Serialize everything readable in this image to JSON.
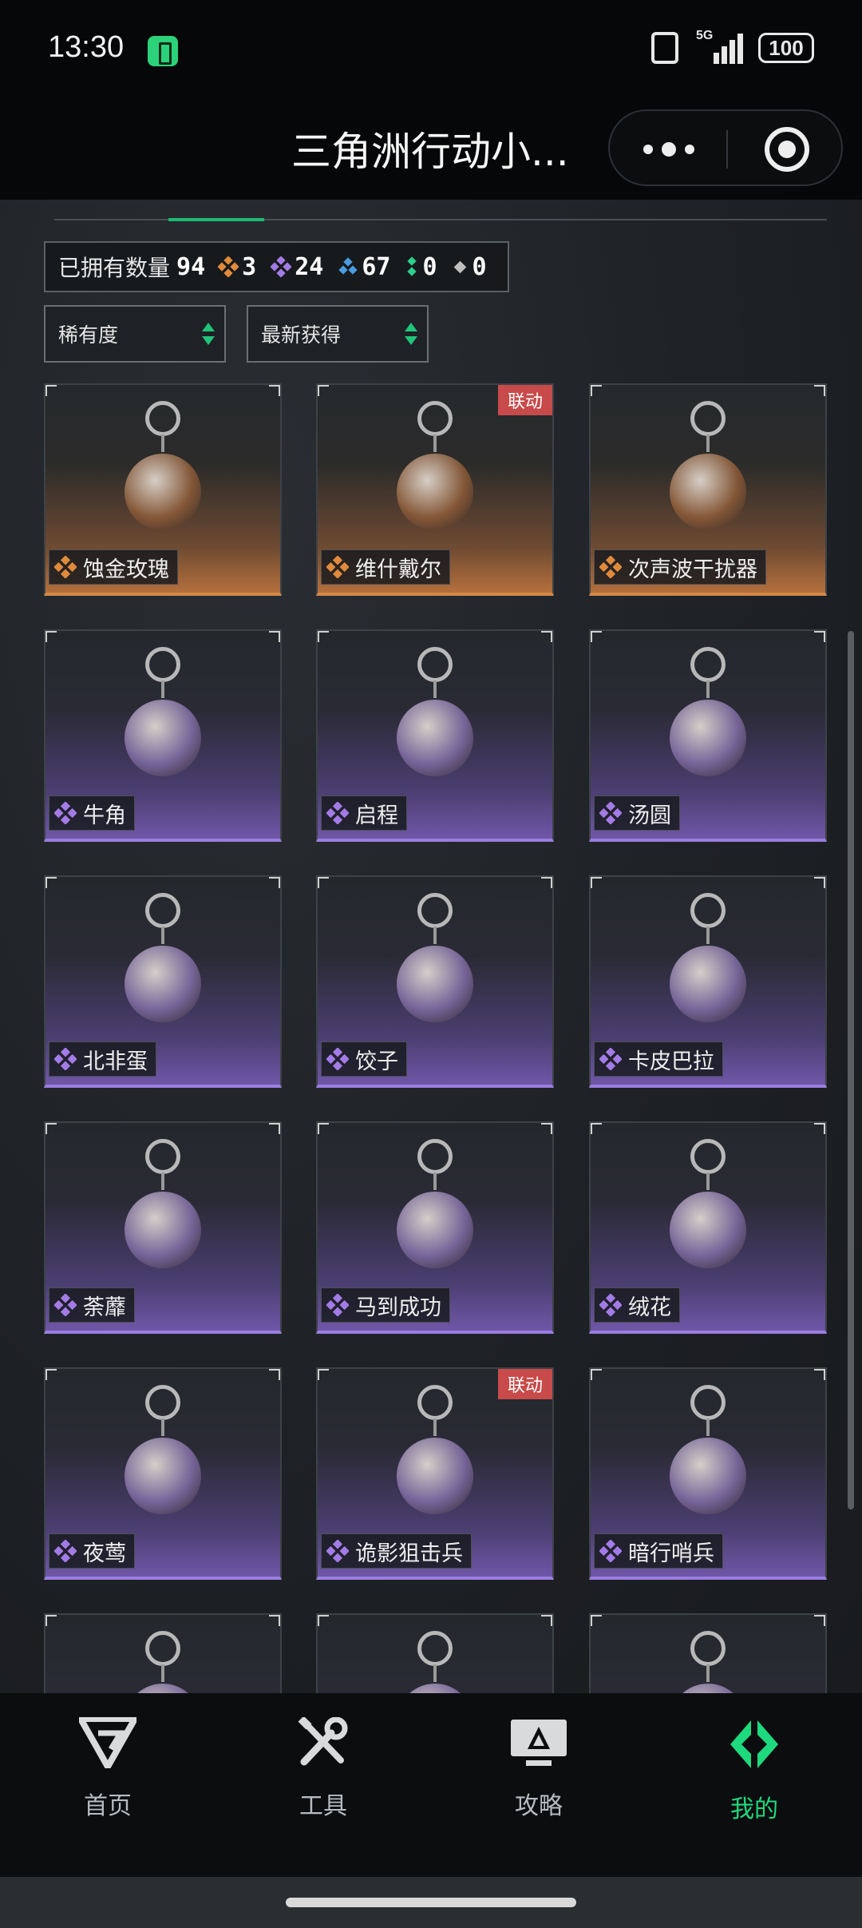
{
  "status_bar": {
    "time": "13:30",
    "network": "5G",
    "battery": "100"
  },
  "title_bar": {
    "title": "三角洲行动小..."
  },
  "collection": {
    "owned_label": "已拥有数量",
    "owned_total": "94",
    "rarity_counts": [
      {
        "color": "#e08a3c",
        "count": "3"
      },
      {
        "color": "#a37be6",
        "count": "24"
      },
      {
        "color": "#4b9be0",
        "count": "67"
      },
      {
        "color": "#2ccf8c",
        "count": "0"
      },
      {
        "color": "#bfbfbf",
        "count": "0"
      }
    ]
  },
  "filters": {
    "sort_rarity": "稀有度",
    "sort_recent": "最新获得"
  },
  "items": [
    {
      "name": "蚀金玫瑰",
      "rarity": "orange",
      "badge": ""
    },
    {
      "name": "维什戴尔",
      "rarity": "orange",
      "badge": "联动"
    },
    {
      "name": "次声波干扰器",
      "rarity": "orange",
      "badge": ""
    },
    {
      "name": "牛角",
      "rarity": "purple",
      "badge": ""
    },
    {
      "name": "启程",
      "rarity": "purple",
      "badge": ""
    },
    {
      "name": "汤圆",
      "rarity": "purple",
      "badge": ""
    },
    {
      "name": "北非蛋",
      "rarity": "purple",
      "badge": ""
    },
    {
      "name": "饺子",
      "rarity": "purple",
      "badge": ""
    },
    {
      "name": "卡皮巴拉",
      "rarity": "purple",
      "badge": ""
    },
    {
      "name": "荼蘼",
      "rarity": "purple",
      "badge": ""
    },
    {
      "name": "马到成功",
      "rarity": "purple",
      "badge": ""
    },
    {
      "name": "绒花",
      "rarity": "purple",
      "badge": ""
    },
    {
      "name": "夜莺",
      "rarity": "purple",
      "badge": ""
    },
    {
      "name": "诡影狙击兵",
      "rarity": "purple",
      "badge": "联动"
    },
    {
      "name": "暗行哨兵",
      "rarity": "purple",
      "badge": ""
    },
    {
      "name": "",
      "rarity": "purple",
      "badge": ""
    },
    {
      "name": "",
      "rarity": "purple",
      "badge": ""
    },
    {
      "name": "",
      "rarity": "purple",
      "badge": ""
    }
  ],
  "bottom_nav": [
    {
      "label": "首页",
      "icon": "delta-logo-icon"
    },
    {
      "label": "工具",
      "icon": "tools-icon"
    },
    {
      "label": "攻略",
      "icon": "guide-monitor-icon"
    },
    {
      "label": "我的",
      "icon": "profile-logo-icon",
      "active": true
    }
  ]
}
